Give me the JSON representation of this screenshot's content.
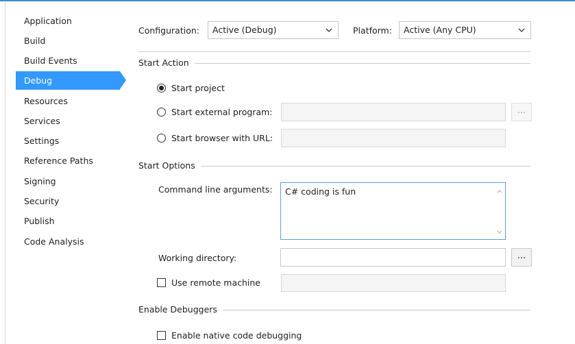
{
  "sidebar": {
    "items": [
      {
        "label": "Application"
      },
      {
        "label": "Build"
      },
      {
        "label": "Build Events"
      },
      {
        "label": "Debug"
      },
      {
        "label": "Resources"
      },
      {
        "label": "Services"
      },
      {
        "label": "Settings"
      },
      {
        "label": "Reference Paths"
      },
      {
        "label": "Signing"
      },
      {
        "label": "Security"
      },
      {
        "label": "Publish"
      },
      {
        "label": "Code Analysis"
      }
    ],
    "selected": "Debug",
    "accent": "#3399ff"
  },
  "config": {
    "configuration_label": "Configuration:",
    "configuration_value": "Active (Debug)",
    "platform_label": "Platform:",
    "platform_value": "Active (Any CPU)"
  },
  "start_action": {
    "title": "Start Action",
    "start_project": "Start project",
    "start_external": "Start external program:",
    "start_browser": "Start browser with URL:",
    "selected": "Start project",
    "browse_label": "..."
  },
  "start_options": {
    "title": "Start Options",
    "cmd_label": "Command line arguments:",
    "cmd_value": "C# coding is fun",
    "workdir_label": "Working directory:",
    "workdir_value": "",
    "browse_label": "...",
    "remote_label": "Use remote machine",
    "remote_value": ""
  },
  "debuggers": {
    "title": "Enable Debuggers",
    "native_label": "Enable native code debugging"
  }
}
